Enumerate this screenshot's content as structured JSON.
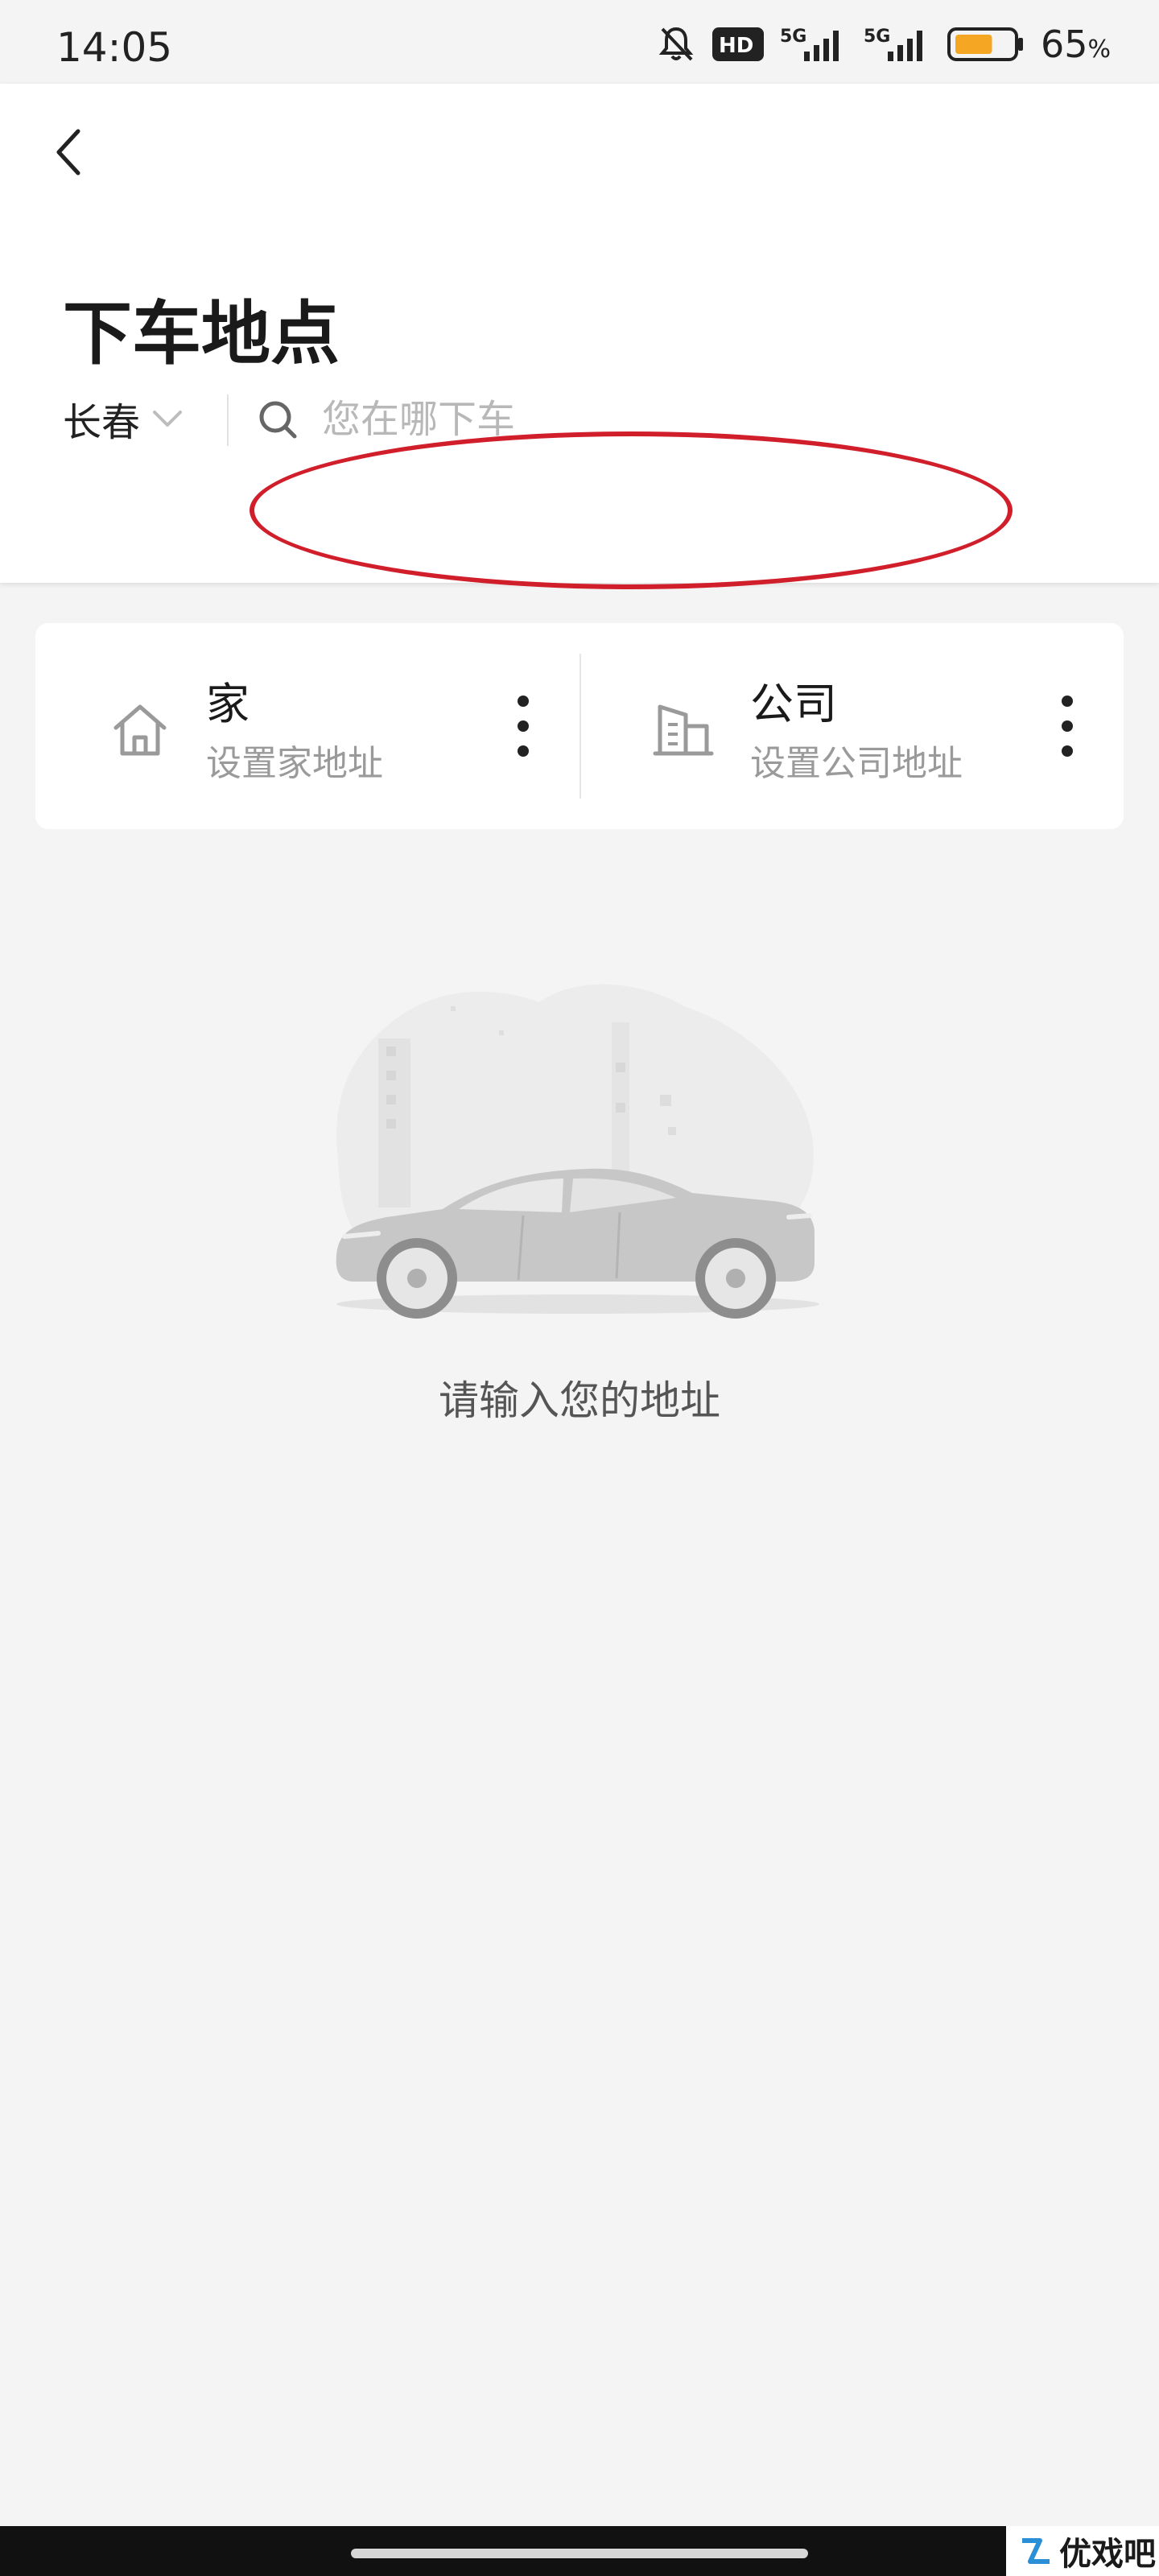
{
  "status_bar": {
    "time": "14:05",
    "network_badge": "HD",
    "network_1": "5G",
    "network_2": "5G",
    "battery_level": 65,
    "battery_text": "65",
    "battery_unit": "%"
  },
  "header": {
    "title": "下车地点",
    "city": "长春",
    "search_placeholder": "您在哪下车"
  },
  "places": [
    {
      "name": "家",
      "hint": "设置家地址",
      "icon": "home-icon"
    },
    {
      "name": "公司",
      "hint": "设置公司地址",
      "icon": "office-building-icon"
    }
  ],
  "empty_state": {
    "message": "请输入您的地址"
  },
  "watermark": {
    "text": "优戏吧"
  },
  "colors": {
    "annotation": "#d11e2b",
    "background": "#f4f4f4",
    "battery_fill": "#f5a623"
  }
}
